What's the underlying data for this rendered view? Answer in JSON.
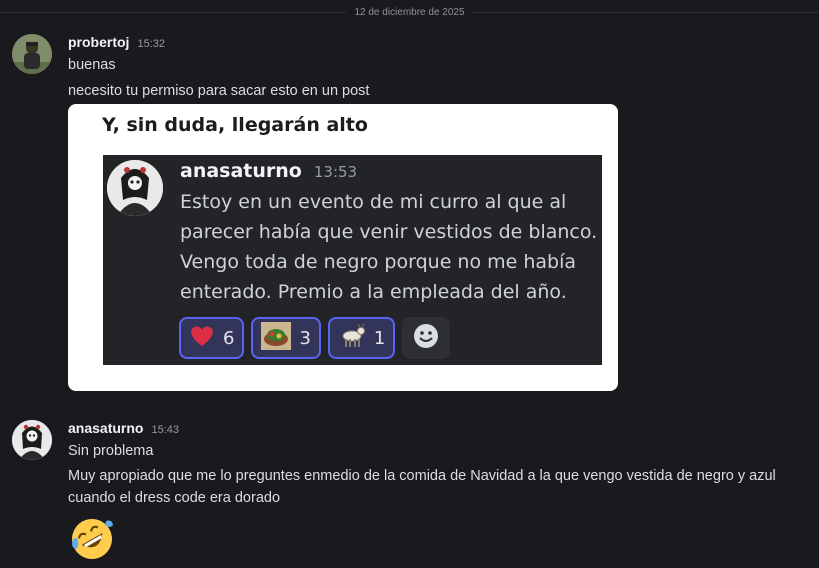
{
  "divider": {
    "date": "12 de diciembre de 2025"
  },
  "messages": [
    {
      "author": "probertoj",
      "time": "15:32",
      "lines": [
        "buenas",
        "necesito tu permiso para sacar esto en un post"
      ],
      "embed": {
        "title": "Y, sin duda, llegarán alto",
        "screenshot": {
          "author": "anasaturno",
          "time": "13:53",
          "text": "Estoy en un evento de mi curro al que al parecer había que venir vestidos de blanco. Vengo toda de negro porque no me había enterado. Premio a la empleada del año.",
          "reactions": [
            {
              "icon": "heart-icon",
              "count": "6"
            },
            {
              "icon": "food-bowl-icon",
              "count": "3"
            },
            {
              "icon": "goat-icon",
              "count": "1"
            }
          ]
        }
      }
    },
    {
      "author": "anasaturno",
      "time": "15:43",
      "lines": [
        "Sin problema",
        "Muy apropiado que me lo preguntes enmedio de la comida de Navidad a la que vengo vestida de negro y azul cuando el dress code era dorado"
      ],
      "emoji": "rofl-emoji"
    }
  ],
  "colors": {
    "background": "#1a1a1e",
    "embed_bg": "#ffffff",
    "screenshot_bg": "#232428",
    "reaction_accent": "#5865f2"
  }
}
